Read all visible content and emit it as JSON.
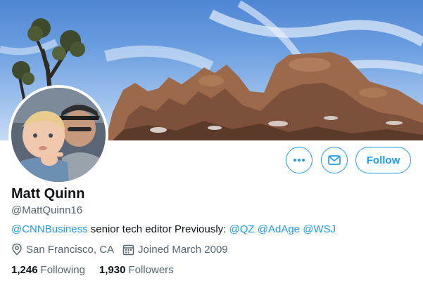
{
  "profile": {
    "name": "Matt Quinn",
    "handle": "@MattQuinn16"
  },
  "actions": {
    "more_icon": "more-icon",
    "message_icon": "mail-icon",
    "follow_label": "Follow"
  },
  "bio": {
    "mention_company": "@CNNBusiness",
    "text_role": " senior tech editor  Previously: ",
    "mention_1": "@QZ",
    "mention_2": "@AdAge",
    "mention_3": "@WSJ"
  },
  "meta": {
    "location_icon": "location-pin-icon",
    "location": "San Francisco, CA",
    "joined_icon": "calendar-icon",
    "joined": "Joined March 2009"
  },
  "stats": {
    "following_count": "1,246",
    "following_label": "Following",
    "followers_count": "1,930",
    "followers_label": "Followers"
  },
  "colors": {
    "accent": "#1d9bf0",
    "text_primary": "#0f1419",
    "text_secondary": "#536471"
  }
}
